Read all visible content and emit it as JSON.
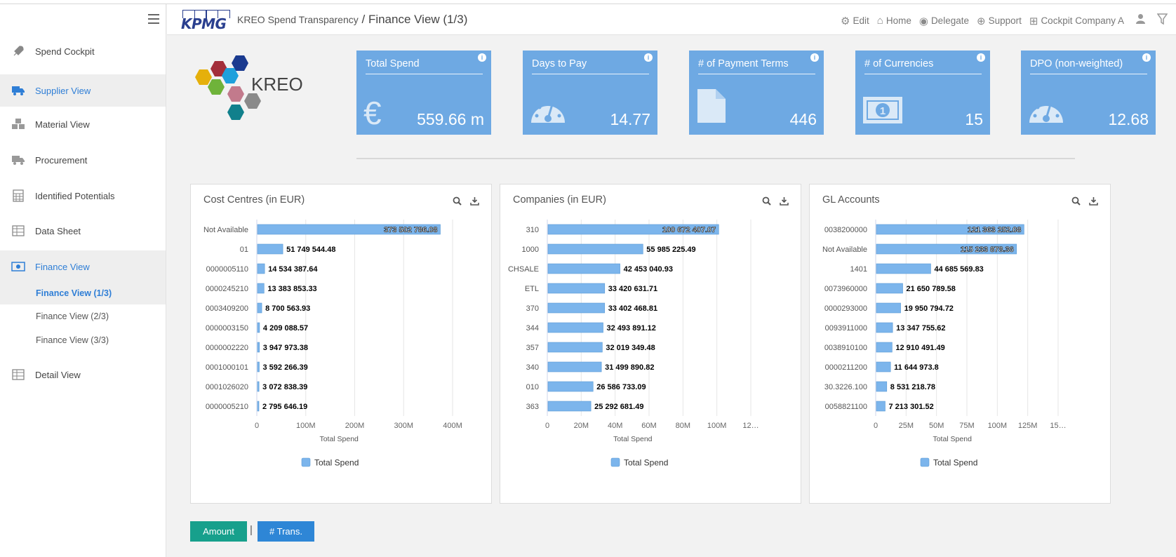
{
  "sidebar": {
    "items": [
      {
        "label": "Spend Cockpit",
        "icon": "rocket-icon"
      },
      {
        "label": "Supplier View",
        "icon": "truck-icon",
        "active": true
      },
      {
        "label": "Material View",
        "icon": "cubes-icon"
      },
      {
        "label": "Procurement",
        "icon": "truck-icon"
      },
      {
        "label": "Identified Potentials",
        "icon": "calculator-icon"
      },
      {
        "label": "Data Sheet",
        "icon": "table-icon"
      },
      {
        "label": "Finance View",
        "icon": "money-icon",
        "active": true
      },
      {
        "label": "Detail View",
        "icon": "table-icon"
      }
    ],
    "sub_items": [
      {
        "label": "Finance View (1/3)",
        "active": true
      },
      {
        "label": "Finance View (2/3)"
      },
      {
        "label": "Finance View (3/3)"
      }
    ]
  },
  "header": {
    "logo_text": "KPMG",
    "app_name": "KREO Spend Transparency",
    "separator": " / ",
    "page_title": "Finance View (1/3)",
    "links": [
      {
        "label": "Edit",
        "icon": "gears-icon"
      },
      {
        "label": "Home",
        "icon": "home-icon"
      },
      {
        "label": "Delegate",
        "icon": "user-circle-icon"
      },
      {
        "label": "Support",
        "icon": "lifebuoy-icon"
      },
      {
        "label": "Cockpit Company A",
        "icon": "sitemap-icon"
      }
    ]
  },
  "kreo_logo_text": "KREO",
  "kpis": [
    {
      "title": "Total Spend",
      "value": "559.66 m",
      "icon": "euro-icon"
    },
    {
      "title": "Days to Pay",
      "value": "14.77",
      "icon": "dashboard-icon"
    },
    {
      "title": "# of Payment Terms",
      "value": "446",
      "icon": "file-icon"
    },
    {
      "title": "# of Currencies",
      "value": "15",
      "icon": "banknote-icon"
    },
    {
      "title": "DPO (non-weighted)",
      "value": "12.68",
      "icon": "dashboard-icon"
    }
  ],
  "chart_data": [
    {
      "type": "bar",
      "title": "Cost Centres (in EUR)",
      "orientation": "horizontal",
      "categories": [
        "Not Available",
        "01",
        "0000005110",
        "0000245210",
        "0003409200",
        "0000003150",
        "0000002220",
        "0001000101",
        "0001026020",
        "0000005210"
      ],
      "values": [
        373502786.08,
        51749544.48,
        14534387.64,
        13383853.33,
        8700563.93,
        4209088.57,
        3947973.38,
        3592266.39,
        3072838.39,
        2795646.19
      ],
      "data_labels": [
        "373 502 786.08",
        "51 749 544.48",
        "14 534 387.64",
        "13 383 853.33",
        "8 700 563.93",
        "4 209 088.57",
        "3 947 973.38",
        "3 592 266.39",
        "3 072 838.39",
        "2 795 646.19"
      ],
      "xticks": [
        "0",
        "100M",
        "200M",
        "300M",
        "400M"
      ],
      "xlim": [
        0,
        400000000
      ],
      "xlabel": "Total Spend",
      "legend": [
        "Total Spend"
      ],
      "color": "#7cb5ec"
    },
    {
      "type": "bar",
      "title": "Companies (in EUR)",
      "orientation": "horizontal",
      "categories": [
        "310",
        "1000",
        "CHSALE",
        "ETL",
        "370",
        "344",
        "357",
        "340",
        "010",
        "363"
      ],
      "values": [
        100672407.07,
        55985225.49,
        42453040.93,
        33420631.71,
        33402468.81,
        32493891.12,
        32019349.48,
        31499890.82,
        26586733.09,
        25292681.49
      ],
      "data_labels": [
        "100 672 407.07",
        "55 985 225.49",
        "42 453 040.93",
        "33 420 631.71",
        "33 402 468.81",
        "32 493 891.12",
        "32 019 349.48",
        "31 499 890.82",
        "26 586 733.09",
        "25 292 681.49"
      ],
      "xticks": [
        "0",
        "20M",
        "40M",
        "60M",
        "80M",
        "100M",
        "12…"
      ],
      "xlim": [
        0,
        120000000
      ],
      "xlabel": "Total Spend",
      "legend": [
        "Total Spend"
      ],
      "color": "#7cb5ec"
    },
    {
      "type": "bar",
      "title": "GL Accounts",
      "orientation": "horizontal",
      "categories": [
        "0038200000",
        "Not Available",
        "1401",
        "0073960000",
        "0000293000",
        "0093911000",
        "0038910100",
        "0000211200",
        "30.3226.100",
        "0058821100"
      ],
      "values": [
        121363252.08,
        115233878.36,
        44685569.83,
        21650789.58,
        19950794.72,
        13347755.62,
        12910491.49,
        11644973.8,
        8531218.78,
        7213301.52
      ],
      "data_labels": [
        "121 363 252.08",
        "115 233 878.36",
        "44 685 569.83",
        "21 650 789.58",
        "19 950 794.72",
        "13 347 755.62",
        "12 910 491.49",
        "11 644 973.8",
        "8 531 218.78",
        "7 213 301.52"
      ],
      "xticks": [
        "0",
        "25M",
        "50M",
        "75M",
        "100M",
        "125M",
        "15…"
      ],
      "xlim": [
        0,
        150000000
      ],
      "xlabel": "Total Spend",
      "legend": [
        "Total Spend"
      ],
      "color": "#7cb5ec"
    }
  ],
  "toggles": {
    "amount_label": "Amount",
    "amount_color": "#17a08c",
    "separator": "|",
    "trans_label": "# Trans.",
    "trans_color": "#2e86d6"
  }
}
